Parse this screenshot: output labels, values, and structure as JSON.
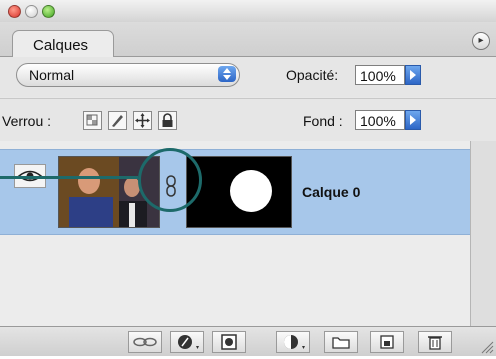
{
  "window": {
    "controls": [
      "close",
      "minimize",
      "zoom"
    ]
  },
  "tabs": [
    {
      "label": "Calques",
      "active": true
    }
  ],
  "panel_menu_icon": "triangle-menu-icon",
  "blend": {
    "mode": "Normal",
    "opacity_label": "Opacité:",
    "opacity_value": "100%"
  },
  "lock": {
    "label": "Verrou :",
    "icons": [
      "lock-transparency-icon",
      "lock-brush-icon",
      "lock-move-icon",
      "lock-all-icon"
    ],
    "fill_label": "Fond :",
    "fill_value": "100%"
  },
  "layers": [
    {
      "name": "Calque 0",
      "visible": true,
      "has_mask": true,
      "selected": true
    }
  ],
  "bottom_icons": [
    "link-icon",
    "fx-icon",
    "mask-icon",
    "adjustment-icon",
    "folder-icon",
    "new-layer-icon",
    "trash-icon"
  ],
  "colors": {
    "selection": "#a7c7ea",
    "accent": "#2d66c6",
    "callout": "#1d6a6a"
  }
}
